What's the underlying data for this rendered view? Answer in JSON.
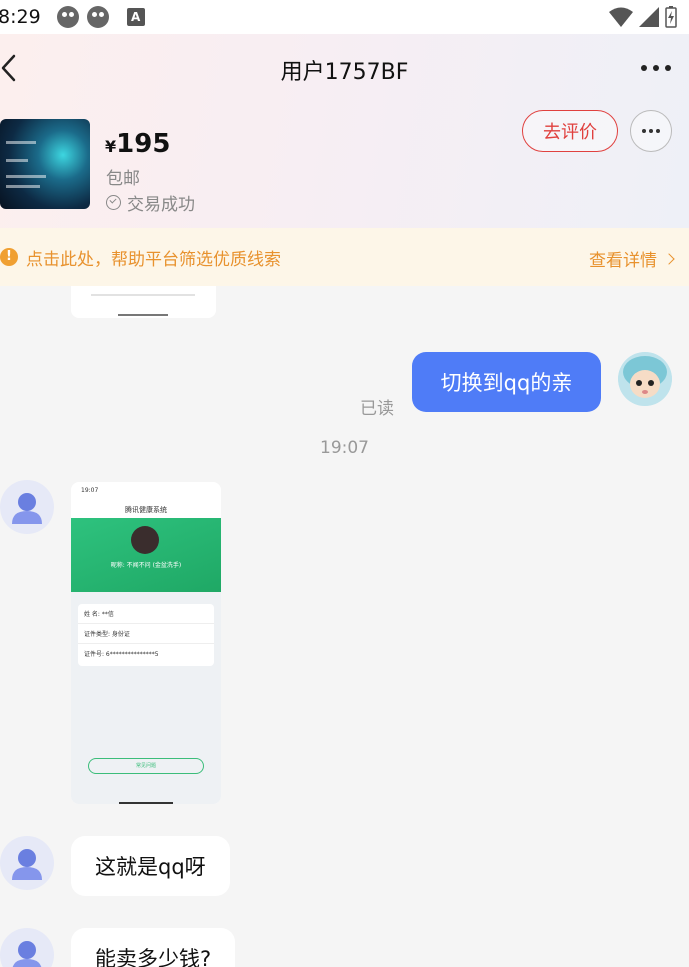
{
  "status_bar": {
    "time": "8:29"
  },
  "nav": {
    "title": "用户1757BF"
  },
  "product": {
    "currency": "¥",
    "price": "195",
    "shipping": "包邮",
    "status": "交易成功",
    "review_label": "去评价"
  },
  "tip": {
    "icon_text": "!",
    "text": "点击此处，帮助平台筛选优质线索",
    "link": "查看详情"
  },
  "messages": {
    "sent_text": "切换到qq的亲",
    "read_status": "已读",
    "timestamp": "19:07",
    "reply1": "这就是qq呀",
    "reply2": "能卖多少钱?"
  },
  "screenshot_card": {
    "status_time": "19:07",
    "title": "腾讯健康系统",
    "name_line": "昵称: 不闻不问 (金盆洗手)",
    "rows": [
      "姓    名: **信",
      "证件类型: 身份证",
      "证件号: 6***************5"
    ],
    "button": "常见问题"
  }
}
